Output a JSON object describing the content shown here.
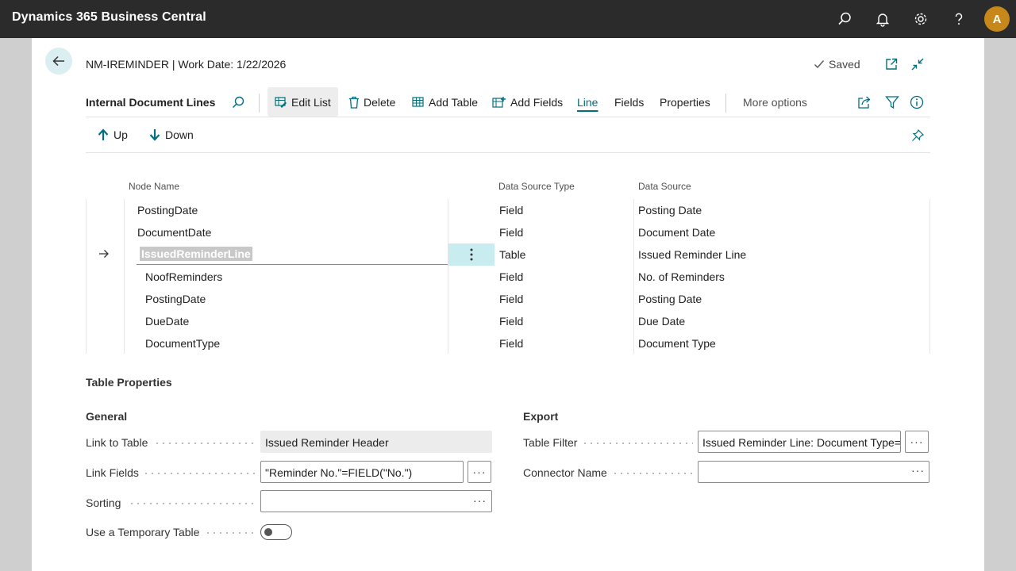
{
  "app": {
    "title": "Dynamics 365 Business Central",
    "avatar_initial": "A"
  },
  "header": {
    "title": "NM-IREMINDER | Work Date: 1/22/2026",
    "saved_label": "Saved"
  },
  "actionbar": {
    "title": "Internal Document Lines",
    "edit_list": "Edit List",
    "delete": "Delete",
    "add_table": "Add Table",
    "add_fields": "Add Fields",
    "line": "Line",
    "fields": "Fields",
    "properties": "Properties",
    "more_options": "More options"
  },
  "subbar": {
    "up": "Up",
    "down": "Down"
  },
  "grid": {
    "columns": {
      "node_name": "Node Name",
      "data_source_type": "Data Source Type",
      "data_source": "Data Source"
    },
    "rows": [
      {
        "node_name": "PostingDate",
        "type": "Field",
        "source": "Posting Date"
      },
      {
        "node_name": "DocumentDate",
        "type": "Field",
        "source": "Document Date"
      },
      {
        "node_name": "IssuedReminderLine",
        "type": "Table",
        "source": "Issued Reminder Line"
      },
      {
        "node_name": "NoofReminders",
        "type": "Field",
        "source": "No. of Reminders"
      },
      {
        "node_name": "PostingDate",
        "type": "Field",
        "source": "Posting Date"
      },
      {
        "node_name": "DueDate",
        "type": "Field",
        "source": "Due Date"
      },
      {
        "node_name": "DocumentType",
        "type": "Field",
        "source": "Document Type"
      }
    ]
  },
  "properties": {
    "section_title": "Table Properties",
    "general": {
      "title": "General",
      "link_to_table_label": "Link to Table",
      "link_to_table_value": "Issued Reminder Header",
      "link_fields_label": "Link Fields",
      "link_fields_value": "\"Reminder No.\"=FIELD(\"No.\")",
      "sorting_label": "Sorting",
      "sorting_value": "",
      "temp_table_label": "Use a Temporary Table",
      "temp_table_on": false
    },
    "export": {
      "title": "Export",
      "table_filter_label": "Table Filter",
      "table_filter_value": "Issued Reminder Line: Document Type=",
      "connector_name_label": "Connector Name",
      "connector_name_value": ""
    }
  },
  "colors": {
    "accent": "#00707f",
    "topbar": "#2b2b2b",
    "avatar": "#c8871b",
    "selected_cell": "#c9ecf0"
  }
}
